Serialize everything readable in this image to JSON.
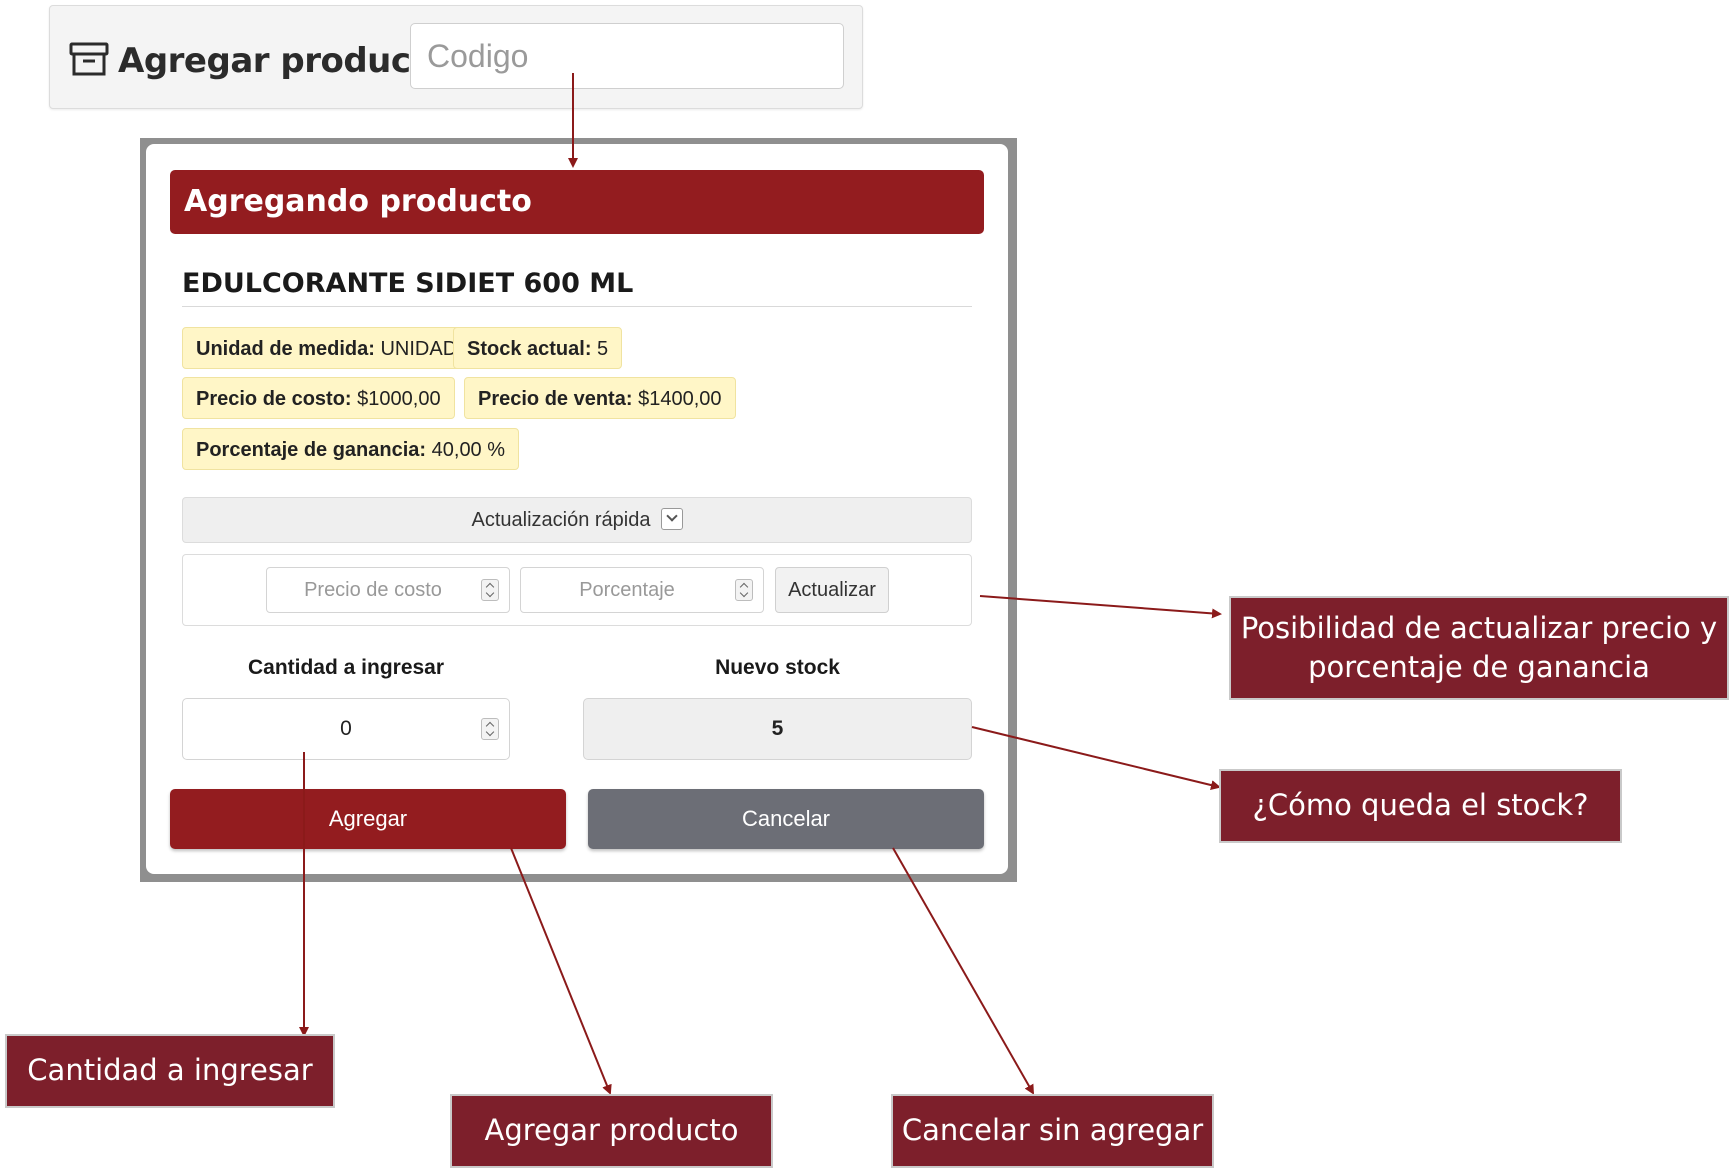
{
  "topbar": {
    "title": "Agregar producto",
    "code_placeholder": "Codigo",
    "icon": "archive-box-icon"
  },
  "modal": {
    "header": "Agregando producto",
    "product_name": "EDULCORANTE SIDIET 600 ML",
    "badges": [
      {
        "key": "Unidad de medida:",
        "value": " UNIDAD"
      },
      {
        "key": "Stock actual:",
        "value": " 5"
      },
      {
        "key": "Precio de costo:",
        "value": " $1000,00"
      },
      {
        "key": "Precio de venta:",
        "value": " $1400,00"
      },
      {
        "key": "Porcentaje de ganancia:",
        "value": " 40,00 %"
      }
    ],
    "quick_update": {
      "title": "Actualización rápida",
      "cost_placeholder": "Precio de costo",
      "percent_placeholder": "Porcentaje",
      "update_button": "Actualizar"
    },
    "quantity_label": "Cantidad a ingresar",
    "quantity_value": "0",
    "new_stock_label": "Nuevo stock",
    "new_stock_value": "5",
    "add_button": "Agregar",
    "cancel_button": "Cancelar"
  },
  "callouts": {
    "update_price": "Posibilidad de actualizar precio y porcentaje de ganancia",
    "stock_result": "¿Cómo queda el stock?",
    "quantity": "Cantidad a ingresar",
    "add_product": "Agregar producto",
    "cancel_without_add": "Cancelar sin agregar"
  },
  "colors": {
    "primary": "#931c1f",
    "callout": "#7d1f2b",
    "cancel": "#6c6e76",
    "badge": "#fff6c7",
    "arrow": "#8b1a1a"
  }
}
